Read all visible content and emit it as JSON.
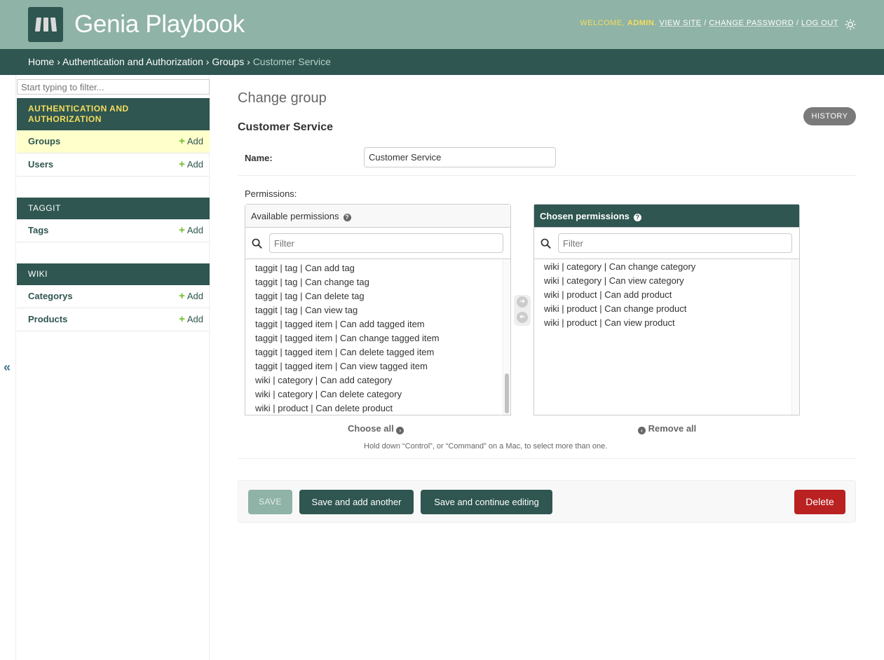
{
  "header": {
    "site_title": "Genia Playbook",
    "welcome": "Welcome,",
    "username": "admin",
    "view_site": "View site",
    "change_password": "Change password",
    "log_out": "Log out",
    "sep": "/"
  },
  "breadcrumbs": {
    "home": "Home",
    "app": "Authentication and Authorization",
    "model": "Groups",
    "current": "Customer Service",
    "sep": "›"
  },
  "sidebar": {
    "filter_placeholder": "Start typing to filter...",
    "add_label": "Add",
    "apps": [
      {
        "caption": "Authentication and Authorization",
        "models": [
          "Groups",
          "Users"
        ]
      },
      {
        "caption": "TAGGIT",
        "models": [
          "Tags"
        ]
      },
      {
        "caption": "WIKI",
        "models": [
          "Categorys",
          "Products"
        ]
      }
    ],
    "collapse": "«"
  },
  "content": {
    "title": "Change group",
    "history": "History",
    "object_title": "Customer Service",
    "name_label": "Name:",
    "name_value": "Customer Service",
    "permissions_label": "Permissions:"
  },
  "available": {
    "header": "Available permissions",
    "filter_placeholder": "Filter",
    "options": [
      "taggit | tag | Can add tag",
      "taggit | tag | Can change tag",
      "taggit | tag | Can delete tag",
      "taggit | tag | Can view tag",
      "taggit | tagged item | Can add tagged item",
      "taggit | tagged item | Can change tagged item",
      "taggit | tagged item | Can delete tagged item",
      "taggit | tagged item | Can view tagged item",
      "wiki | category | Can add category",
      "wiki | category | Can delete category",
      "wiki | product | Can delete product"
    ],
    "choose_all": "Choose all"
  },
  "chosen": {
    "header": "Chosen permissions",
    "filter_placeholder": "Filter",
    "options": [
      "wiki | category | Can change category",
      "wiki | category | Can view category",
      "wiki | product | Can add product",
      "wiki | product | Can change product",
      "wiki | product | Can view product"
    ],
    "remove_all": "Remove all"
  },
  "help_text": "Hold down “Control”, or “Command” on a Mac, to select more than one.",
  "actions": {
    "save": "SAVE",
    "save_add": "Save and add another",
    "save_continue": "Save and continue editing",
    "delete": "Delete"
  },
  "colors": {
    "header_bg": "#8fb3a6",
    "primary": "#2f5650",
    "accent_yellow": "#f5dd5d",
    "delete": "#ba2121"
  }
}
